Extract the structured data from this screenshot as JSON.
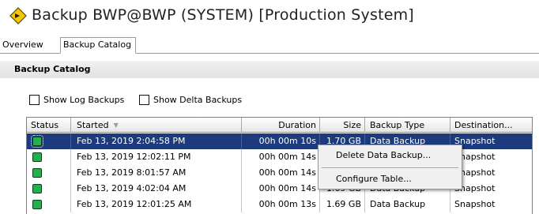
{
  "header": {
    "title": "Backup BWP@BWP (SYSTEM) [Production System]",
    "icon": "warning-diamond-icon",
    "icon_color": "#f5c800"
  },
  "tabs": [
    {
      "label": "Overview"
    },
    {
      "label": "Backup Catalog",
      "active": true
    }
  ],
  "section": {
    "title": "Backup Catalog"
  },
  "filters": {
    "show_log_backups": {
      "label": "Show Log Backups",
      "checked": false
    },
    "show_delta_backups": {
      "label": "Show Delta Backups",
      "checked": false
    }
  },
  "table": {
    "columns": {
      "status": "Status",
      "started": "Started",
      "duration": "Duration",
      "size": "Size",
      "type": "Backup Type",
      "destination": "Destination..."
    },
    "rows": [
      {
        "status": "green",
        "started": "Feb 13, 2019 2:04:58 PM",
        "duration": "00h 00m 10s",
        "size": "1.70 GB",
        "type": "Data Backup",
        "destination": "Snapshot"
      },
      {
        "status": "green",
        "started": "Feb 13, 2019 12:02:11 PM",
        "duration": "00h 00m 14s",
        "size": "",
        "type": "",
        "destination": "Snapshot"
      },
      {
        "status": "green",
        "started": "Feb 13, 2019 8:01:57 AM",
        "duration": "00h 00m 14s",
        "size": "",
        "type": "",
        "destination": "Snapshot"
      },
      {
        "status": "green",
        "started": "Feb 13, 2019 4:02:04 AM",
        "duration": "00h 00m 14s",
        "size": "1.69 GB",
        "type": "Data Backup",
        "destination": "Snapshot"
      },
      {
        "status": "green",
        "started": "Feb 13, 2019 12:01:25 AM",
        "duration": "00h 00m 13s",
        "size": "1.69 GB",
        "type": "Data Backup",
        "destination": "Snapshot"
      }
    ],
    "selected_row": 0,
    "status_color": "#22b14c",
    "selection_color": "#1c3a7c"
  },
  "context_menu": {
    "items": [
      "Delete Data Backup...",
      "Configure Table..."
    ]
  }
}
